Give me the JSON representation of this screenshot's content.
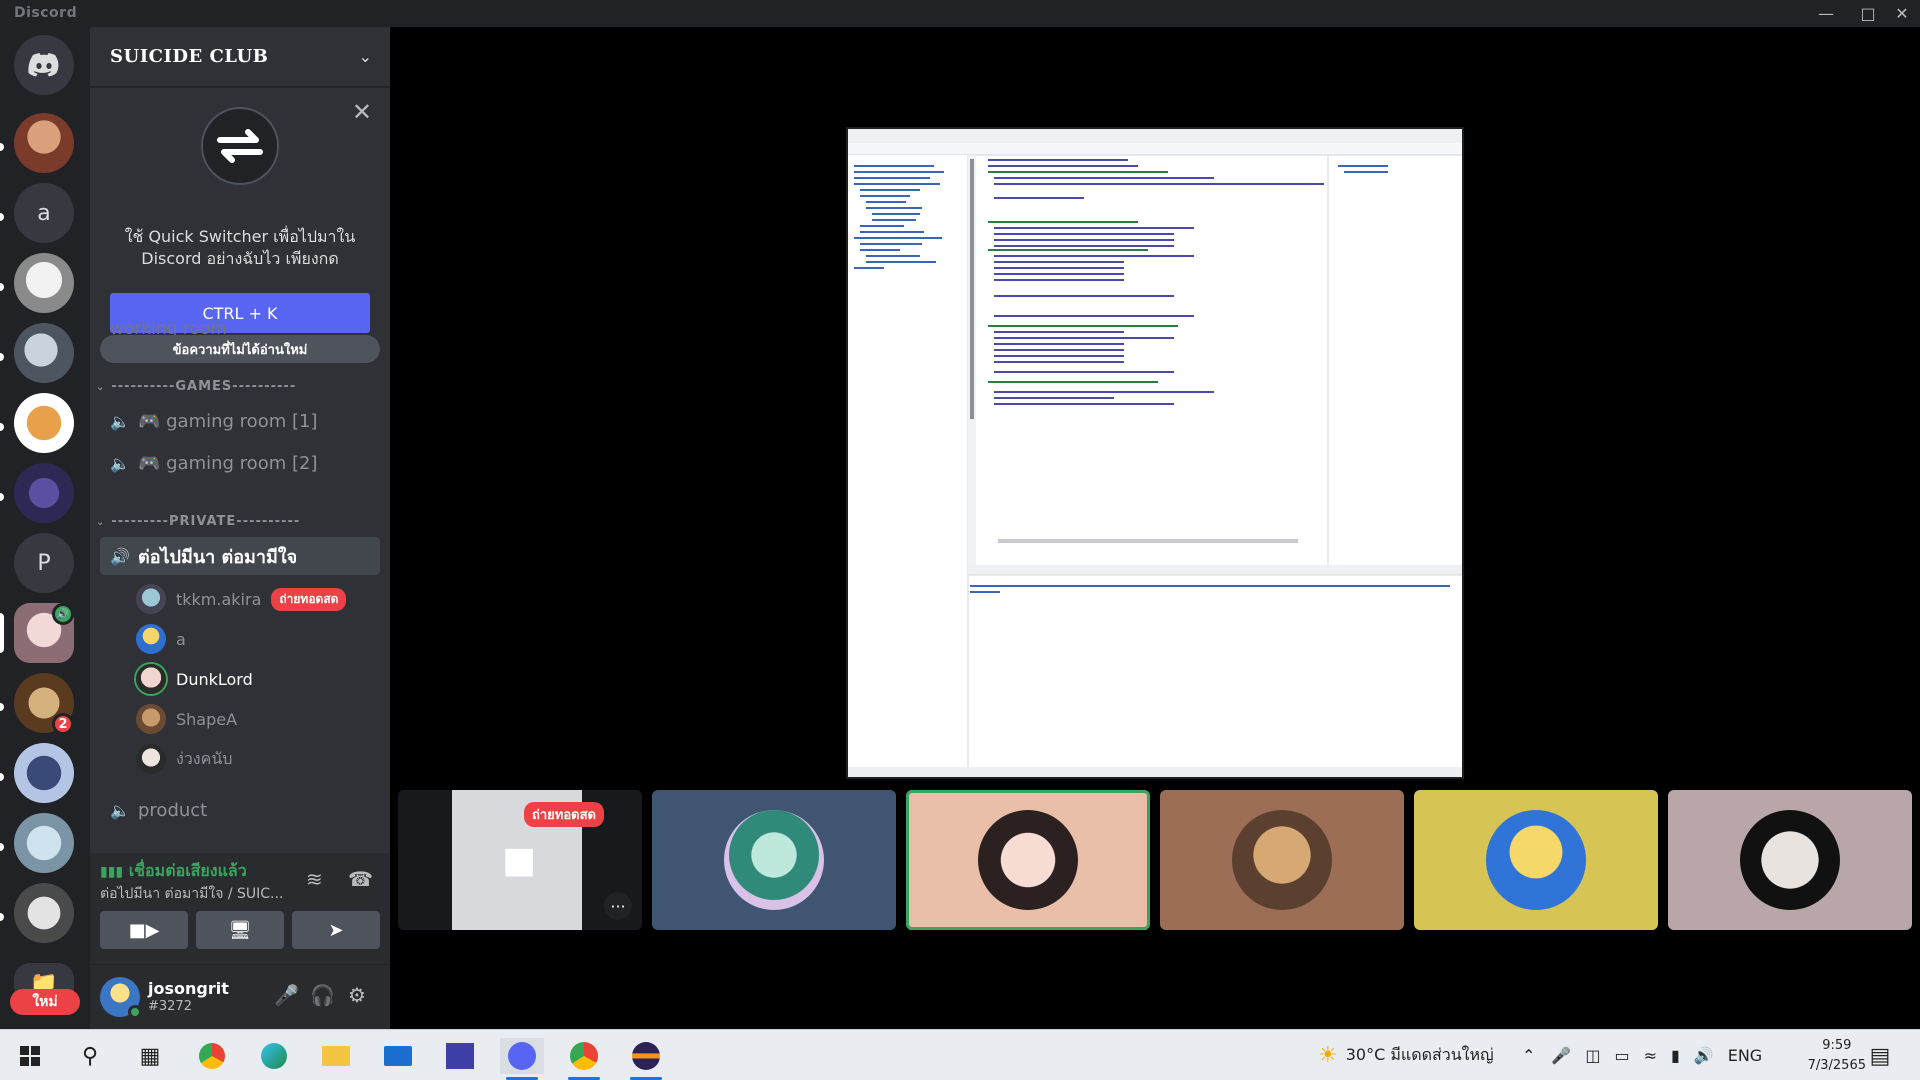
{
  "window": {
    "title": "Discord"
  },
  "rail": {
    "home_label": "Discord",
    "text_server_initial": "a",
    "text_server_initial_2": "P",
    "mention_count": "2",
    "new_label": "ใหม่"
  },
  "server": {
    "name": "SUICIDE CLUB"
  },
  "quick_switcher": {
    "line1": "ใช้ Quick Switcher เพื่อไปมาใน",
    "line2": "Discord อย่างฉับไว เพียงกด",
    "shortcut": "CTRL + K"
  },
  "faded_channel": "working room",
  "unread_label": "ข้อความที่ไม่ได้อ่านใหม่",
  "categories": {
    "games": "----------GAMES----------",
    "private": "---------PRIVATE----------"
  },
  "channels": {
    "game1": "🎮 gaming room [1]",
    "game2": "🎮 gaming room [2]",
    "private_active": "ต่อไปมีนา ต่อมามีใจ",
    "product": "product"
  },
  "voice_users": [
    {
      "name": "tkkm.akira",
      "live": "ถ่ายทอดสด"
    },
    {
      "name": "a"
    },
    {
      "name": "DunkLord"
    },
    {
      "name": "ShapeA"
    },
    {
      "name": "ง่วงคนับ"
    }
  ],
  "voice_panel": {
    "status": "เชื่อมต่อเสียงแล้ว",
    "channel": "ต่อไปมีนา ต่อมามีใจ / SUIC..."
  },
  "user": {
    "name": "josongrit",
    "tag": "#3272"
  },
  "stream_tile": {
    "live": "ถ่ายทอดสด",
    "more": "···"
  },
  "tiles": [
    {
      "color": "#3f5572"
    },
    {
      "color": "#e9bfaa"
    },
    {
      "color": "#9b6e55"
    },
    {
      "color": "#d6c454"
    },
    {
      "color": "#b9a6a8"
    }
  ],
  "taskbar": {
    "weather": "30°C มีแดดส่วนใหญ่",
    "language": "ENG",
    "time": "9:59",
    "date": "7/3/2565"
  },
  "colors": {
    "blurple": "#5865f2",
    "green": "#3ba55d",
    "red": "#ed4245"
  }
}
